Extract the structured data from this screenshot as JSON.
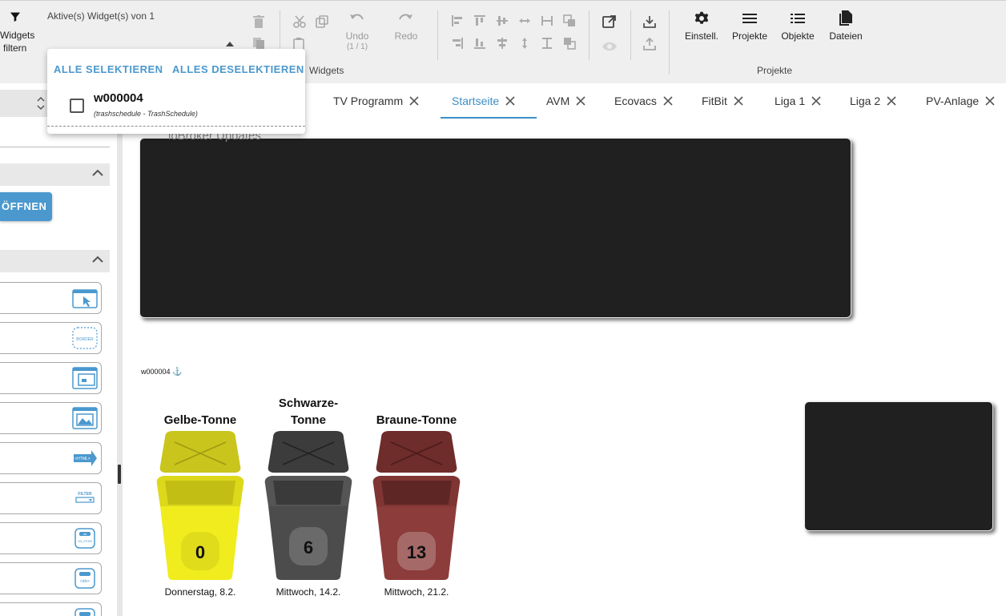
{
  "toolbar": {
    "active_widgets_label": "Aktive(s) Widget(s) von 1",
    "filter_label_1": "Widgets",
    "filter_label_2": "filtern",
    "undo_label": "Undo",
    "undo_count": "(1 / 1)",
    "redo_label": "Redo",
    "widgets_group_label": "Widgets",
    "projects_group_label": "Projekte",
    "settings_label": "Einstell.",
    "projects_label": "Projekte",
    "objects_label": "Objekte",
    "files_label": "Dateien"
  },
  "popup": {
    "select_all": "ALLE SELEKTIEREN",
    "deselect_all": "ALLES DESELEKTIEREN",
    "widget_id": "w000004",
    "widget_sub": "(trashschedule - TrashSchedule)"
  },
  "sidebar": {
    "open_button": "ÖFFNEN",
    "widget_icons": [
      "BORDER",
      "<HTML>",
      "FILTER",
      "val",
      "VIS_OTHER",
      "<div>"
    ]
  },
  "tabs": [
    {
      "label": "TV Programm"
    },
    {
      "label": "Startseite"
    },
    {
      "label": "AVM"
    },
    {
      "label": "Ecovacs"
    },
    {
      "label": "FitBit"
    },
    {
      "label": "Liga 1"
    },
    {
      "label": "Liga 2"
    },
    {
      "label": "PV-Anlage"
    }
  ],
  "active_tab": "Startseite",
  "canvas": {
    "dark_box_title": "ioBroker Updates",
    "widget_id_label": "w000004",
    "anchor_glyph": "⚓",
    "bins": [
      {
        "name": "Gelbe-Tonne",
        "days": "0",
        "date": "Donnerstag, 8.2.",
        "color": "#e6e21a",
        "lid_color": "#c8c41a",
        "dark": "#b5b015"
      },
      {
        "name": "Schwarze-Tonne",
        "name_line1": "Schwarze-",
        "name_line2": "Tonne",
        "days": "6",
        "date": "Mittwoch, 14.2.",
        "color": "#4a4a4a",
        "lid_color": "#3a3a3a",
        "dark": "#2e2e2e"
      },
      {
        "name": "Braune-Tonne",
        "days": "13",
        "date": "Mittwoch, 21.2.",
        "color": "#8a3a38",
        "lid_color": "#6e2c2b",
        "dark": "#5a2423"
      }
    ]
  },
  "colors": {
    "accent": "#4a98ce",
    "toolbar_bg": "#efefef",
    "dark_widget": "#202020"
  }
}
